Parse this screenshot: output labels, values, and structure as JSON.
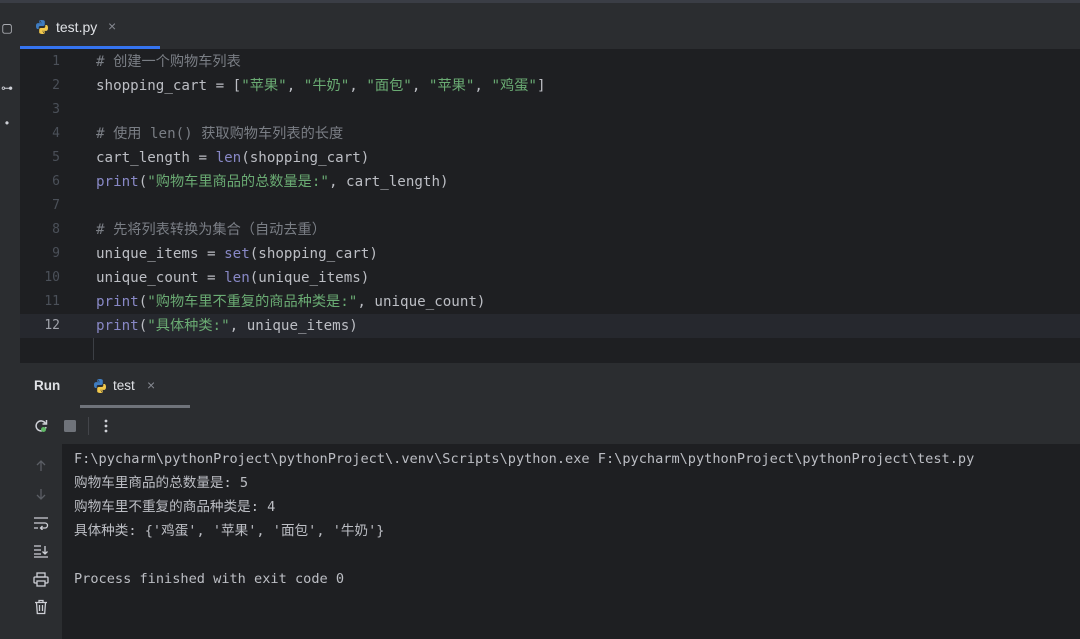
{
  "editor_tab": {
    "label": "test.py",
    "close": "×"
  },
  "editor": {
    "lines": [
      {
        "num": "1",
        "segments": [
          {
            "t": "# 创建一个购物车列表",
            "c": "cm"
          }
        ]
      },
      {
        "num": "2",
        "segments": [
          {
            "t": "shopping_cart = [",
            "c": ""
          },
          {
            "t": "\"苹果\"",
            "c": "str"
          },
          {
            "t": ", ",
            "c": ""
          },
          {
            "t": "\"牛奶\"",
            "c": "str"
          },
          {
            "t": ", ",
            "c": ""
          },
          {
            "t": "\"面包\"",
            "c": "str"
          },
          {
            "t": ", ",
            "c": ""
          },
          {
            "t": "\"苹果\"",
            "c": "str"
          },
          {
            "t": ", ",
            "c": ""
          },
          {
            "t": "\"鸡蛋\"",
            "c": "str"
          },
          {
            "t": "]",
            "c": ""
          }
        ]
      },
      {
        "num": "3",
        "segments": []
      },
      {
        "num": "4",
        "segments": [
          {
            "t": "# 使用 len() 获取购物车列表的长度",
            "c": "cm"
          }
        ]
      },
      {
        "num": "5",
        "segments": [
          {
            "t": "cart_length = ",
            "c": ""
          },
          {
            "t": "len",
            "c": "bi"
          },
          {
            "t": "(shopping_cart)",
            "c": ""
          }
        ]
      },
      {
        "num": "6",
        "segments": [
          {
            "t": "print",
            "c": "bi"
          },
          {
            "t": "(",
            "c": ""
          },
          {
            "t": "\"购物车里商品的总数量是:\"",
            "c": "str"
          },
          {
            "t": ", cart_length)",
            "c": ""
          }
        ]
      },
      {
        "num": "7",
        "segments": []
      },
      {
        "num": "8",
        "segments": [
          {
            "t": "# 先将列表转换为集合（自动去重）",
            "c": "cm"
          }
        ]
      },
      {
        "num": "9",
        "segments": [
          {
            "t": "unique_items = ",
            "c": ""
          },
          {
            "t": "set",
            "c": "bi"
          },
          {
            "t": "(shopping_cart)",
            "c": ""
          }
        ]
      },
      {
        "num": "10",
        "segments": [
          {
            "t": "unique_count = ",
            "c": ""
          },
          {
            "t": "len",
            "c": "bi"
          },
          {
            "t": "(unique_items)",
            "c": ""
          }
        ]
      },
      {
        "num": "11",
        "segments": [
          {
            "t": "print",
            "c": "bi"
          },
          {
            "t": "(",
            "c": ""
          },
          {
            "t": "\"购物车里不重复的商品种类是:\"",
            "c": "str"
          },
          {
            "t": ", unique_count)",
            "c": ""
          }
        ]
      },
      {
        "num": "12",
        "segments": [
          {
            "t": "print",
            "c": "bi"
          },
          {
            "t": "(",
            "c": ""
          },
          {
            "t": "\"具体种类:\"",
            "c": "str"
          },
          {
            "t": ", unique_items)",
            "c": ""
          }
        ],
        "current": true
      }
    ]
  },
  "run_panel": {
    "title": "Run",
    "tab_label": "test",
    "tab_close": "×",
    "output": [
      "F:\\pycharm\\pythonProject\\pythonProject\\.venv\\Scripts\\python.exe F:\\pycharm\\pythonProject\\pythonProject\\test.py",
      "购物车里商品的总数量是: 5",
      "购物车里不重复的商品种类是: 4",
      "具体种类: {'鸡蛋', '苹果', '面包', '牛奶'}",
      "",
      "Process finished with exit code 0"
    ]
  },
  "colors": {
    "accent": "#3574f0",
    "comment": "#7a7e85",
    "string": "#6aab73",
    "builtin": "#8888c6",
    "text": "#bcbec4"
  }
}
